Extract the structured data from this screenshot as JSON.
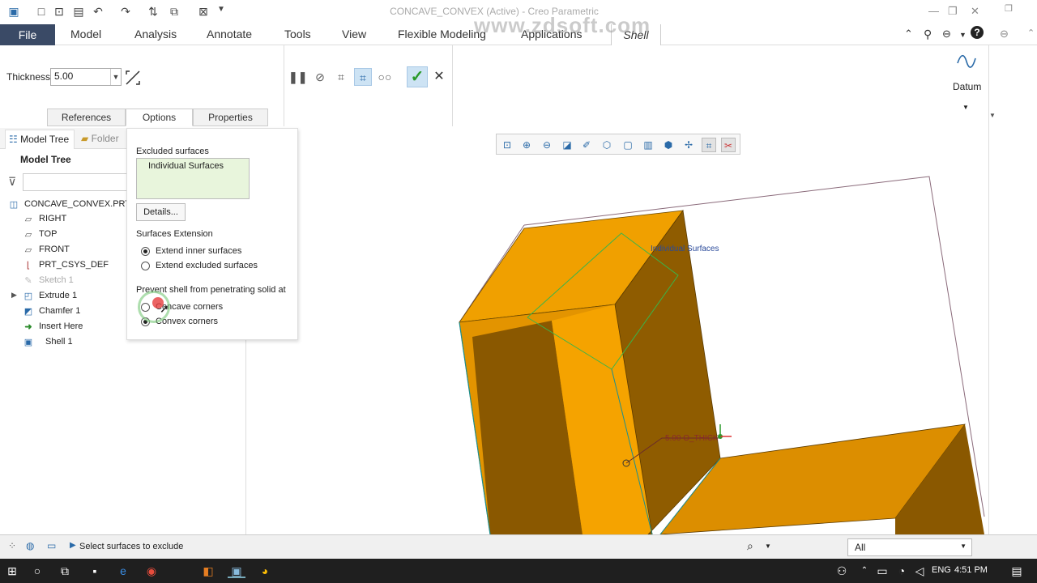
{
  "window": {
    "title": "CONCAVE_CONVEX (Active) - Creo Parametric",
    "watermark": "www.zdsoft.com"
  },
  "menu": {
    "file": "File",
    "tabs": [
      "Model",
      "Analysis",
      "Annotate",
      "Tools",
      "View",
      "Flexible Modeling",
      "Applications"
    ],
    "active_tab": "Shell"
  },
  "ribbon": {
    "thickness_label": "Thickness",
    "thickness_value": "5.00",
    "subtabs": [
      "References",
      "Options",
      "Properties"
    ],
    "datum_label": "Datum"
  },
  "model_tree": {
    "tabs": [
      "Model Tree",
      "Folder"
    ],
    "title": "Model Tree",
    "items": [
      {
        "label": "CONCAVE_CONVEX.PRT",
        "icon": "part-icon"
      },
      {
        "label": "RIGHT",
        "icon": "datum-plane-icon"
      },
      {
        "label": "TOP",
        "icon": "datum-plane-icon"
      },
      {
        "label": "FRONT",
        "icon": "datum-plane-icon"
      },
      {
        "label": "PRT_CSYS_DEF",
        "icon": "csys-icon"
      },
      {
        "label": "Sketch 1",
        "icon": "sketch-icon"
      },
      {
        "label": "Extrude 1",
        "icon": "extrude-icon"
      },
      {
        "label": "Chamfer 1",
        "icon": "chamfer-icon"
      },
      {
        "label": "Insert Here",
        "icon": "insert-arrow-icon"
      },
      {
        "label": "Shell 1",
        "icon": "shell-icon"
      }
    ]
  },
  "options_panel": {
    "excluded_title": "Excluded surfaces",
    "excluded_item": "Individual Surfaces",
    "details_button": "Details...",
    "surfaces_extension_title": "Surfaces Extension",
    "extend_inner": "Extend inner surfaces",
    "extend_excluded": "Extend excluded surfaces",
    "prevent_title": "Prevent shell from penetrating solid at",
    "concave": "Concave corners",
    "convex": "Convex corners"
  },
  "viewport": {
    "annotation_surfaces": "Individual Surfaces",
    "annotation_thick": "5.00 O_THICK"
  },
  "status": {
    "message": "Select surfaces to exclude",
    "filter": "All"
  },
  "taskbar": {
    "lang": "ENG",
    "time": "4:51 PM"
  },
  "colors": {
    "file_tab": "#3a4a66",
    "solid_light": "#f5a000",
    "solid_mid": "#d68a00",
    "solid_dark": "#8a5800",
    "edge": "#1d8f8f",
    "excluded_bg": "#e8f5dc"
  }
}
